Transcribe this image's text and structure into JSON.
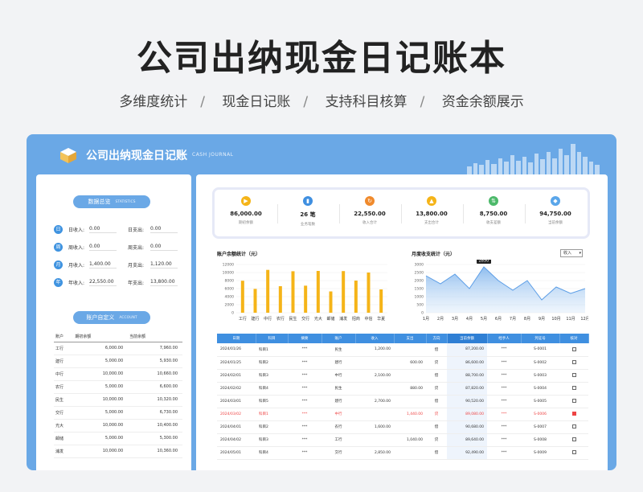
{
  "hero": {
    "title": "公司出纳现金日记账本",
    "features": [
      "多维度统计",
      "现金日记账",
      "支持科目核算",
      "资金余额展示"
    ],
    "sep": "/"
  },
  "panel": {
    "title": "公司出纳现金日记账",
    "subtitle": "CASH JOURNAL"
  },
  "left": {
    "stats_pill": {
      "label": "数据总览",
      "sub": "STATISTICS"
    },
    "stats": [
      {
        "icon": "日",
        "in_label": "日收入:",
        "in_value": "0.00",
        "out_label": "日支出:",
        "out_value": "0.00"
      },
      {
        "icon": "周",
        "in_label": "周收入:",
        "in_value": "0.00",
        "out_label": "周支出:",
        "out_value": "0.00"
      },
      {
        "icon": "月",
        "in_label": "月收入:",
        "in_value": "1,400.00",
        "out_label": "月支出:",
        "out_value": "1,120.00"
      },
      {
        "icon": "年",
        "in_label": "年收入:",
        "in_value": "22,550.00",
        "out_label": "年支出:",
        "out_value": "13,800.00"
      }
    ],
    "acct_pill": {
      "label": "账户自定义",
      "sub": "ACCOUNT"
    },
    "acct_headers": [
      "账户",
      "期初余额",
      "当前余额"
    ],
    "accounts": [
      [
        "工行",
        "6,000.00",
        "7,960.00"
      ],
      [
        "建行",
        "5,000.00",
        "5,930.00"
      ],
      [
        "中行",
        "10,000.00",
        "10,660.00"
      ],
      [
        "农行",
        "5,000.00",
        "6,600.00"
      ],
      [
        "民生",
        "10,000.00",
        "10,320.00"
      ],
      [
        "交行",
        "5,000.00",
        "6,730.00"
      ],
      [
        "光大",
        "10,000.00",
        "10,400.00"
      ],
      [
        "邮储",
        "5,000.00",
        "5,300.00"
      ],
      [
        "浦发",
        "10,000.00",
        "10,360.00"
      ]
    ]
  },
  "kpis": [
    {
      "icon": "▶",
      "color": "#f5b418",
      "value": "86,000.00",
      "label": "期初余额"
    },
    {
      "icon": "▮",
      "color": "#3f8fe0",
      "value": "26 笔",
      "label": "业务笔数"
    },
    {
      "icon": "↻",
      "color": "#f08a2c",
      "value": "22,550.00",
      "label": "收入合计"
    },
    {
      "icon": "▲",
      "color": "#f5b418",
      "value": "13,800.00",
      "label": "支出合计"
    },
    {
      "icon": "⇅",
      "color": "#4cb96a",
      "value": "8,750.00",
      "label": "收支差额"
    },
    {
      "icon": "◆",
      "color": "#5aa6ea",
      "value": "94,750.00",
      "label": "当前余额"
    }
  ],
  "charts": {
    "bar_title": "账户余额统计（元）",
    "line_title": "月度收支统计（元）",
    "line_select": "收入",
    "line_tooltip": "2850"
  },
  "chart_data": [
    {
      "type": "bar",
      "categories": [
        "工行",
        "建行",
        "中行",
        "农行",
        "民生",
        "交行",
        "光大",
        "邮储",
        "浦发",
        "招商",
        "中信",
        "华夏"
      ],
      "values": [
        7960,
        5930,
        10660,
        6600,
        10320,
        6730,
        10400,
        5300,
        10360,
        8000,
        10000,
        5800
      ],
      "ylim": [
        0,
        12000
      ],
      "yticks": [
        "0",
        "2000",
        "4000",
        "6000",
        "8000",
        "10000",
        "12000"
      ],
      "color": "#f5b418"
    },
    {
      "type": "area",
      "categories": [
        "1月",
        "2月",
        "3月",
        "4月",
        "5月",
        "6月",
        "7月",
        "8月",
        "9月",
        "10月",
        "11月",
        "12月"
      ],
      "values": [
        2300,
        1800,
        2400,
        1500,
        2850,
        2000,
        1400,
        2000,
        800,
        1600,
        1200,
        1500
      ],
      "ylim": [
        0,
        3000
      ],
      "yticks": [
        "0",
        "500",
        "1000",
        "1500",
        "2000",
        "2500",
        "3000"
      ],
      "color": "#5b9de6"
    }
  ],
  "ledger": {
    "headers": [
      "日期",
      "科目",
      "摘要",
      "账户",
      "收入",
      "支出",
      "方向",
      "当前余额",
      "经手人",
      "凭证号",
      "核对"
    ],
    "rows": [
      {
        "c": [
          "2024/01/26",
          "科目1",
          "***",
          "民生",
          "1,200.00",
          "",
          "借",
          "87,200.00",
          "***",
          "S-0001"
        ],
        "hl": false,
        "chk": false
      },
      {
        "c": [
          "2024/01/25",
          "科目2",
          "***",
          "建行",
          "",
          "600.00",
          "贷",
          "86,600.00",
          "***",
          "S-0002"
        ],
        "hl": false,
        "chk": false
      },
      {
        "c": [
          "2024/02/01",
          "科目3",
          "***",
          "中行",
          "2,100.00",
          "",
          "借",
          "88,700.00",
          "***",
          "S-0003"
        ],
        "hl": false,
        "chk": false
      },
      {
        "c": [
          "2024/02/02",
          "科目4",
          "***",
          "民生",
          "",
          "880.00",
          "贷",
          "87,820.00",
          "***",
          "S-0004"
        ],
        "hl": false,
        "chk": false
      },
      {
        "c": [
          "2024/03/01",
          "科目5",
          "***",
          "建行",
          "2,700.00",
          "",
          "借",
          "90,520.00",
          "***",
          "S-0005"
        ],
        "hl": false,
        "chk": false
      },
      {
        "c": [
          "2024/03/02",
          "科目1",
          "***",
          "中行",
          "",
          "1,440.00",
          "贷",
          "89,080.00",
          "***",
          "S-0006"
        ],
        "hl": true,
        "chk": true
      },
      {
        "c": [
          "2024/04/01",
          "科目2",
          "***",
          "农行",
          "1,600.00",
          "",
          "借",
          "90,680.00",
          "***",
          "S-0007"
        ],
        "hl": false,
        "chk": false
      },
      {
        "c": [
          "2024/04/02",
          "科目3",
          "***",
          "工行",
          "",
          "1,040.00",
          "贷",
          "89,640.00",
          "***",
          "S-0008"
        ],
        "hl": false,
        "chk": false
      },
      {
        "c": [
          "2024/05/01",
          "科目4",
          "***",
          "交行",
          "2,850.00",
          "",
          "借",
          "92,490.00",
          "***",
          "S-0009"
        ],
        "hl": false,
        "chk": false
      }
    ]
  }
}
